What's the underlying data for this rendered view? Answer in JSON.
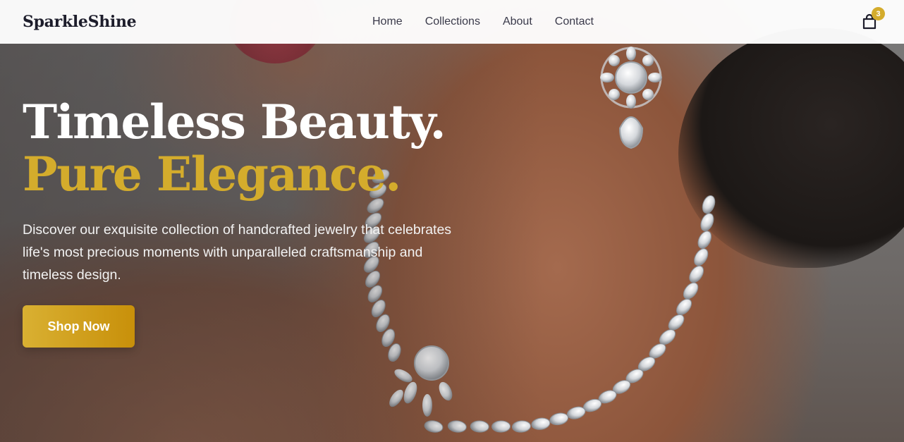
{
  "header": {
    "logo": "SparkleShine",
    "nav": [
      {
        "label": "Home"
      },
      {
        "label": "Collections"
      },
      {
        "label": "About"
      },
      {
        "label": "Contact"
      }
    ],
    "cart_count": "3",
    "cart_icon": "shopping-bag-icon"
  },
  "hero": {
    "headline_1": "Timeless Beauty.",
    "headline_2": "Pure Elegance.",
    "description": "Discover our exquisite collection of handcrafted jewelry that celebrates life's most precious moments with unparalleled craftsmanship and timeless design.",
    "cta_label": "Shop Now"
  },
  "colors": {
    "accent_gold": "#d4ac2c",
    "logo_text": "#1d1d2b",
    "nav_text": "#3a3a4a"
  }
}
